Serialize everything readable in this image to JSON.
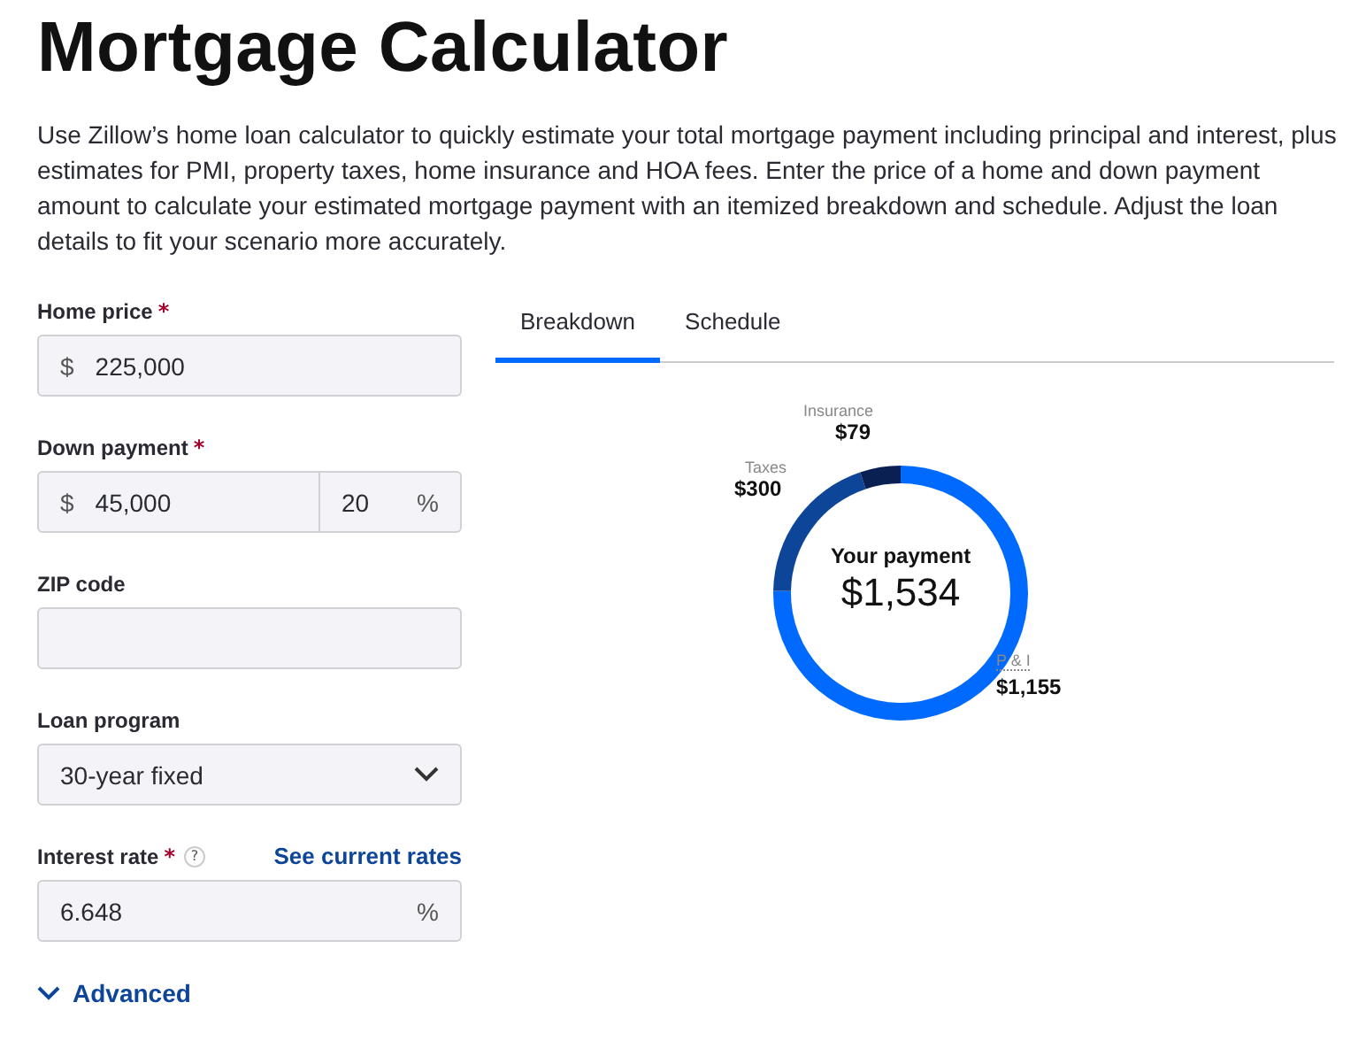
{
  "page": {
    "title": "Mortgage Calculator",
    "intro": "Use Zillow’s home loan calculator to quickly estimate your total mortgage payment including principal and interest, plus estimates for PMI, property taxes, home insurance and HOA fees. Enter the price of a home and down payment amount to calculate your estimated mortgage payment with an itemized breakdown and schedule. Adjust the loan details to fit your scenario more accurately."
  },
  "form": {
    "fields": [
      {
        "kind": "currency",
        "label": "Home price",
        "required_mark": "*",
        "prefix": "$",
        "value": "225,000"
      },
      {
        "kind": "split",
        "label": "Down payment",
        "required_mark": "*",
        "prefix": "$",
        "value": "45,000",
        "percent_value": "20",
        "suffix": "%"
      },
      {
        "kind": "text",
        "label": "ZIP code"
      },
      {
        "kind": "select",
        "label": "Loan program",
        "value": "30-year fixed"
      },
      {
        "kind": "percent",
        "label": "Interest rate",
        "required_mark": "*",
        "help": "?",
        "link": "See current rates",
        "value": "6.648",
        "suffix": "%"
      }
    ],
    "advanced": {
      "label": "Advanced",
      "expanded": false
    }
  },
  "tabs": [
    {
      "label": "Breakdown",
      "selected": true
    },
    {
      "label": "Schedule",
      "selected": false
    }
  ],
  "breakdown": {
    "center_label": "Your payment",
    "center_value": "$1,534",
    "chart_data": {
      "type": "donut",
      "categories": [
        "P & I",
        "Taxes",
        "Insurance"
      ],
      "series": [
        {
          "colors": [
            "#006aff",
            "#0d4599",
            "#0a1f52"
          ],
          "values": [
            75.29,
            19.56,
            5.15
          ]
        }
      ],
      "value_labels": [
        "$1,155",
        "$300",
        "$79"
      ]
    }
  }
}
